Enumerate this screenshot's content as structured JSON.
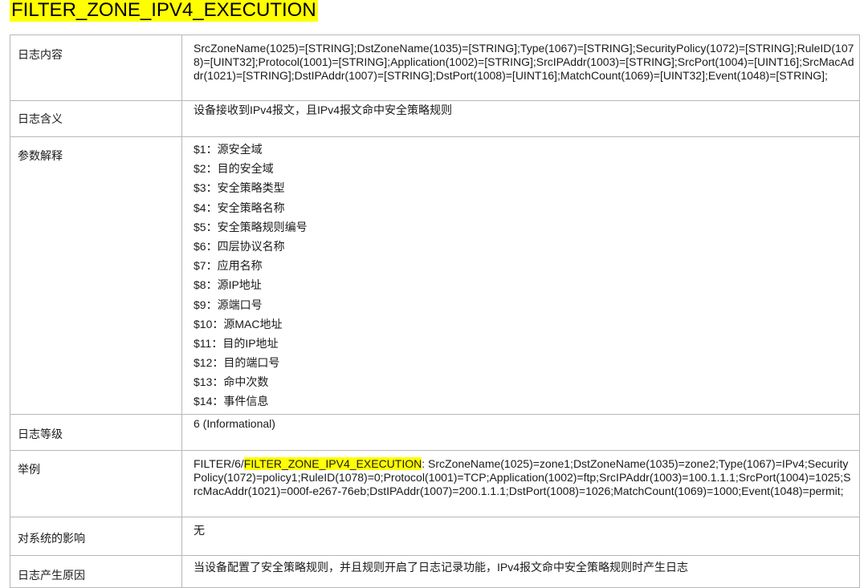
{
  "title": "FILTER_ZONE_IPV4_EXECUTION",
  "colors": {
    "highlight": "#ffff00",
    "border": "#b7b7b7"
  },
  "rows": {
    "content": {
      "label": "日志内容",
      "text": "SrcZoneName(1025)=[STRING];DstZoneName(1035)=[STRING];Type(1067)=[STRING];SecurityPolicy(1072)=[STRING];RuleID(1078)=[UINT32];Protocol(1001)=[STRING];Application(1002)=[STRING];SrcIPAddr(1003)=[STRING];SrcPort(1004)=[UINT16];SrcMacAddr(1021)=[STRING];DstIPAddr(1007)=[STRING];DstPort(1008)=[UINT16];MatchCount(1069)=[UINT32];Event(1048)=[STRING];"
    },
    "meaning": {
      "label": "日志含义",
      "text": "设备接收到IPv4报文，且IPv4报文命中安全策略规则"
    },
    "params": {
      "label": "参数解释",
      "items": [
        "$1：源安全域",
        "$2：目的安全域",
        "$3：安全策略类型",
        "$4：安全策略名称",
        "$5：安全策略规则编号",
        "$6：四层协议名称",
        "$7：应用名称",
        "$8：源IP地址",
        "$9：源端口号",
        "$10：源MAC地址",
        "$11：目的IP地址",
        "$12：目的端口号",
        "$13：命中次数",
        "$14：事件信息"
      ]
    },
    "level": {
      "label": "日志等级",
      "text": "6 (Informational)"
    },
    "example": {
      "label": "举例",
      "prefix": "FILTER/6/",
      "highlight": "FILTER_ZONE_IPV4_EXECUTION",
      "suffix": ":  SrcZoneName(1025)=zone1;DstZoneName(1035)=zone2;Type(1067)=IPv4;SecurityPolicy(1072)=policy1;RuleID(1078)=0;Protocol(1001)=TCP;Application(1002)=ftp;SrcIPAddr(1003)=100.1.1.1;SrcPort(1004)=1025;SrcMacAddr(1021)=000f-e267-76eb;DstIPAddr(1007)=200.1.1.1;DstPort(1008)=1026;MatchCount(1069)=1000;Event(1048)=permit;"
    },
    "impact": {
      "label": "对系统的影响",
      "text": "无"
    },
    "cause": {
      "label": "日志产生原因",
      "text": "当设备配置了安全策略规则，并且规则开启了日志记录功能，IPv4报文命中安全策略规则时产生日志"
    }
  }
}
